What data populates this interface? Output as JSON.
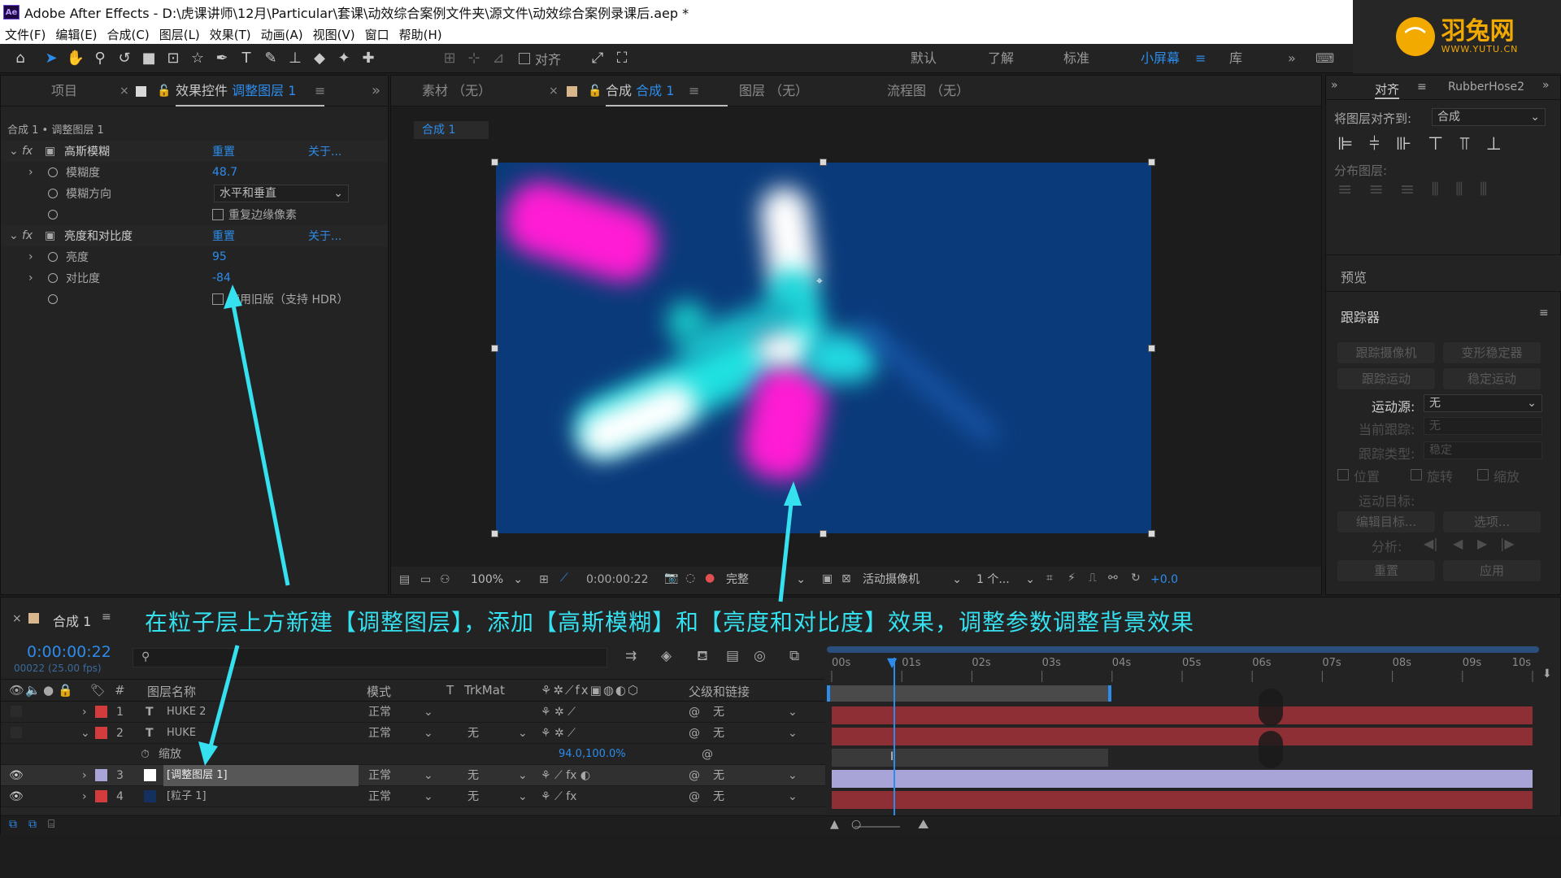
{
  "window": {
    "title": "Adobe After Effects - D:\\虎课讲师\\12月\\Particular\\套课\\动效综合案例文件夹\\源文件\\动效综合案例录课后.aep *",
    "app_icon": "Ae"
  },
  "menu": [
    "文件(F)",
    "编辑(E)",
    "合成(C)",
    "图层(L)",
    "效果(T)",
    "动画(A)",
    "视图(V)",
    "窗口",
    "帮助(H)"
  ],
  "toolbar": {
    "align_label": "对齐",
    "workspaces": [
      "默认",
      "了解",
      "标准",
      "小屏幕",
      "库"
    ],
    "active_workspace": "小屏幕"
  },
  "brand": {
    "name": "羽兔网",
    "url": "WWW.YUTU.CN"
  },
  "left_panel": {
    "tabs": [
      "项目",
      "效果控件 调整图层 1"
    ],
    "tab_project": "项目",
    "tab_effects_prefix": "效果控件",
    "tab_effects_layer": "调整图层 1",
    "breadcrumb": "合成 1 • 调整图层 1",
    "effects": [
      {
        "name": "高斯模糊",
        "reset": "重置",
        "about": "关于...",
        "props": [
          {
            "label": "模糊度",
            "value": "48.7"
          },
          {
            "label": "模糊方向",
            "value": "水平和垂直"
          },
          {
            "label": "",
            "value": "重复边缘像素"
          }
        ]
      },
      {
        "name": "亮度和对比度",
        "reset": "重置",
        "about": "关于...",
        "props": [
          {
            "label": "亮度",
            "value": "95"
          },
          {
            "label": "对比度",
            "value": "-84"
          },
          {
            "label": "",
            "value": "使用旧版（支持 HDR）"
          }
        ]
      }
    ]
  },
  "viewer": {
    "tabs": [
      "素材 （无）",
      "合成 合成 1",
      "图层 （无）",
      "流程图 （无）"
    ],
    "tab_footage": "素材 （无）",
    "tab_comp_prefix": "合成",
    "tab_comp_name": "合成 1",
    "tab_layer": "图层 （无）",
    "tab_flow": "流程图 （无）",
    "comp_chip": "合成 1",
    "zoom": "100%",
    "timecode": "0:00:00:22",
    "quality": "完整",
    "camera": "活动摄像机",
    "views": "1 个...",
    "exposure": "+0.0"
  },
  "right_panel": {
    "align_tab": "对齐",
    "rubberhose_tab": "RubberHose2",
    "align_to_label": "将图层对齐到:",
    "align_to_value": "合成",
    "distribute_label": "分布图层:",
    "preview_label": "预览",
    "tracker_label": "跟踪器",
    "btn_track_camera": "跟踪摄像机",
    "btn_warp_stabilizer": "变形稳定器",
    "btn_track_motion": "跟踪运动",
    "btn_stabilize_motion": "稳定运动",
    "motion_source_label": "运动源:",
    "motion_source_value": "无",
    "current_track_label": "当前跟踪:",
    "current_track_value": "无",
    "track_type_label": "跟踪类型:",
    "track_type_value": "稳定",
    "position": "位置",
    "rotation": "旋转",
    "scale": "缩放",
    "motion_target": "运动目标:",
    "edit_target": "编辑目标...",
    "options": "选项...",
    "analyze": "分析:",
    "reset": "重置",
    "apply": "应用"
  },
  "timeline": {
    "comp_tab": "合成 1",
    "timecode": "0:00:00:22",
    "fps": "00022 (25.00 fps)",
    "columns": {
      "num": "#",
      "layer_name": "图层名称",
      "mode": "模式",
      "t": "T",
      "trkmat": "TrkMat",
      "parent": "父级和链接"
    },
    "layers": [
      {
        "num": "1",
        "type": "T",
        "name": "HUKE 2",
        "mode": "正常",
        "trkmat": "",
        "parent": "无",
        "color": "#d23c3c"
      },
      {
        "num": "2",
        "type": "T",
        "name": "HUKE",
        "mode": "正常",
        "trkmat": "无",
        "parent": "无",
        "color": "#d23c3c"
      },
      {
        "num": "3",
        "type": "",
        "name": "[调整图层 1]",
        "mode": "正常",
        "trkmat": "无",
        "parent": "无",
        "color": "#a8a4d8"
      },
      {
        "num": "4",
        "type": "",
        "name": "[粒子 1]",
        "mode": "正常",
        "trkmat": "无",
        "parent": "无",
        "color": "#d23c3c"
      }
    ],
    "sub_prop_label": "缩放",
    "sub_prop_value": "94.0,100.0%",
    "ruler": [
      "00s",
      "01s",
      "02s",
      "03s",
      "04s",
      "05s",
      "06s",
      "07s",
      "08s",
      "09s",
      "10s"
    ]
  },
  "caption": "在粒子层上方新建【调整图层】，添加【高斯模糊】和【亮度和对比度】效果，调整参数调整背景效果",
  "colors": {
    "accent": "#2d8ceb",
    "annotation": "#35e0ef",
    "layer_red": "#8e2f36",
    "adjust_lavender": "#a8a4d8"
  }
}
